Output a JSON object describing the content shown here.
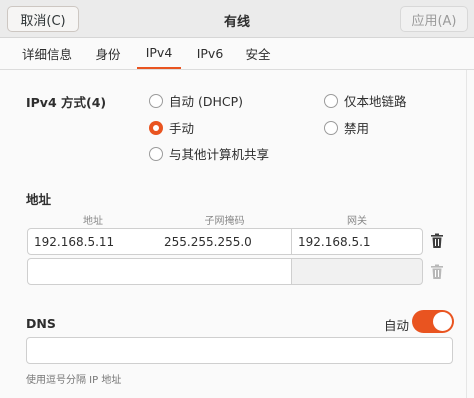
{
  "header": {
    "cancel_label": "取消(C)",
    "title": "有线",
    "apply_label": "应用(A)"
  },
  "tabs": [
    {
      "label": "详细信息"
    },
    {
      "label": "身份"
    },
    {
      "label": "IPv4"
    },
    {
      "label": "IPv6"
    },
    {
      "label": "安全"
    }
  ],
  "active_tab": "IPv4",
  "method": {
    "label": "IPv4 方式(4)",
    "options": [
      {
        "label": "自动 (DHCP)",
        "checked": false
      },
      {
        "label": "手动",
        "checked": true
      },
      {
        "label": "与其他计算机共享",
        "checked": false
      },
      {
        "label": "仅本地链路",
        "checked": false
      },
      {
        "label": "禁用",
        "checked": false
      }
    ]
  },
  "addresses": {
    "title": "地址",
    "columns": [
      "地址",
      "子网掩码",
      "网关"
    ],
    "rows": [
      [
        "192.168.5.11",
        "255.255.255.0",
        "192.168.5.1"
      ],
      [
        "",
        "",
        ""
      ]
    ]
  },
  "dns": {
    "title": "DNS",
    "auto_label": "自动",
    "auto_enabled": true,
    "value": "",
    "hint": "使用逗号分隔 IP 地址"
  },
  "colors": {
    "accent": "#e95420"
  },
  "icons": {
    "delete": "trash-icon",
    "toggle": "switch"
  }
}
